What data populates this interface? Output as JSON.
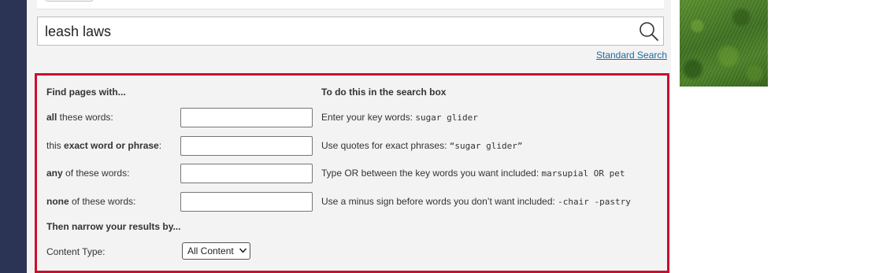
{
  "search": {
    "value": "leash laws",
    "standard_link": "Standard Search"
  },
  "advanced": {
    "find_heading": "Find pages with...",
    "todo_heading": "To do this in the search box",
    "rows": [
      {
        "label_bold": "all",
        "label_rest": " these words:",
        "field_value": "",
        "hint_text": "Enter your key words: ",
        "hint_code": "sugar glider"
      },
      {
        "label_pre": "this ",
        "label_bold": "exact word or phrase",
        "label_rest": ":",
        "field_value": "",
        "hint_text": "Use quotes for exact phrases: ",
        "hint_code": "“sugar glider”"
      },
      {
        "label_bold": "any",
        "label_rest": " of these words:",
        "field_value": "",
        "hint_text": "Type OR between the key words you want included: ",
        "hint_code": "marsupial OR pet"
      },
      {
        "label_bold": "none",
        "label_rest": " of these words:",
        "field_value": "",
        "hint_text": "Use a minus sign before words you don’t want included: ",
        "hint_code": "-chair -pastry"
      }
    ],
    "narrow_heading": "Then narrow your results by...",
    "content_type_label": "Content Type:",
    "content_type_selected": "All Content"
  },
  "colors": {
    "accent_border": "#c8102e",
    "link": "#1a6aa5",
    "left_rail": "#2b3454"
  },
  "icons": {
    "search_button": "magnifier-icon",
    "select_caret": "chevron-down-icon"
  }
}
